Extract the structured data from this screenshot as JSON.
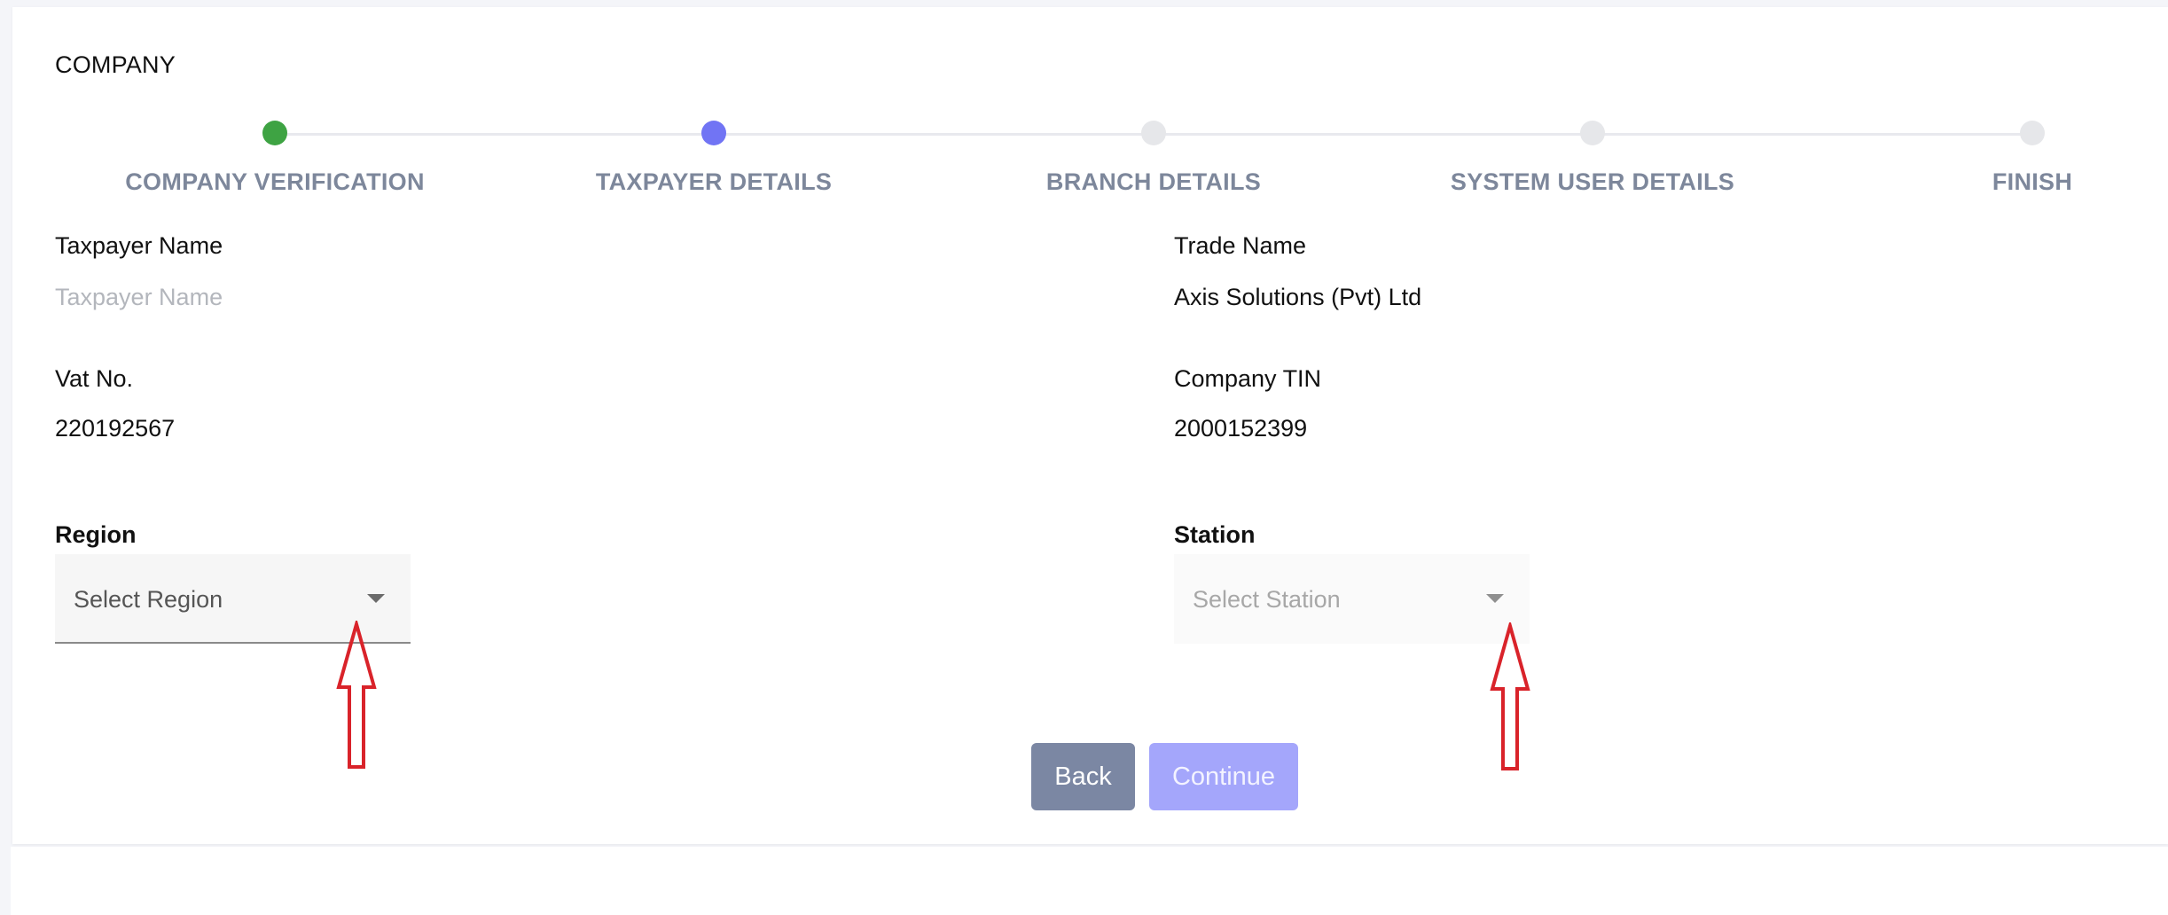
{
  "card": {
    "title": "COMPANY"
  },
  "stepper": {
    "steps": [
      {
        "label": "COMPANY VERIFICATION",
        "state": "done"
      },
      {
        "label": "TAXPAYER DETAILS",
        "state": "active"
      },
      {
        "label": "BRANCH DETAILS",
        "state": "pending"
      },
      {
        "label": "SYSTEM USER DETAILS",
        "state": "pending"
      },
      {
        "label": "FINISH",
        "state": "pending"
      }
    ],
    "colors": {
      "done": "#3ea343",
      "active": "#7174f4",
      "pending": "#e6e7ea"
    }
  },
  "form": {
    "taxpayer_name": {
      "label": "Taxpayer Name",
      "placeholder": "Taxpayer Name"
    },
    "trade_name": {
      "label": "Trade Name",
      "value": "Axis Solutions (Pvt) Ltd"
    },
    "vat_no": {
      "label": "Vat No.",
      "value": "220192567"
    },
    "company_tin": {
      "label": "Company TIN",
      "value": "2000152399"
    },
    "region": {
      "label": "Region",
      "placeholder": "Select Region"
    },
    "station": {
      "label": "Station",
      "placeholder": "Select Station"
    }
  },
  "buttons": {
    "back": "Back",
    "continue": "Continue"
  },
  "annotations": {
    "arrow_color": "#d9232a"
  }
}
